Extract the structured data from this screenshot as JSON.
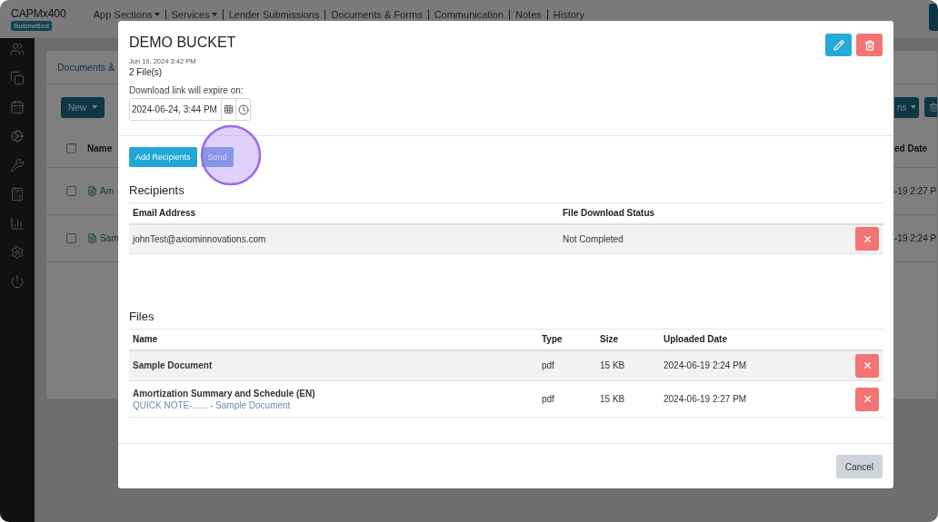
{
  "header": {
    "app_name": "CAPMx400",
    "status_badge": "Submitted",
    "nav": [
      {
        "label": "App Sections",
        "dropdown": true
      },
      {
        "label": "Services",
        "dropdown": true
      },
      {
        "label": "Lender Submissions",
        "dropdown": false
      },
      {
        "label": "Documents & Forms",
        "dropdown": false
      },
      {
        "label": "Communication",
        "dropdown": false
      },
      {
        "label": "Notes",
        "dropdown": false
      },
      {
        "label": "History",
        "dropdown": false
      }
    ]
  },
  "background_panel": {
    "tab": "Documents &",
    "new_button": "New",
    "select_all_checked": false,
    "name_header": "Name",
    "right_button": "ns",
    "date_header": "ed Date",
    "rows": [
      {
        "checked": false,
        "name": "Am",
        "date": "-19 2:27 P"
      },
      {
        "checked": false,
        "name": "Sam",
        "date": "-19 2:24 P"
      }
    ]
  },
  "modal": {
    "title": "DEMO BUCKET",
    "created": "Jun 19, 2024 3:42 PM",
    "file_count": "2 File(s)",
    "expiry_label": "Download link will expire on:",
    "expiry_value": "2024-06-24, 3:44 PM",
    "actions": [
      "Add Recipients",
      "Send"
    ],
    "recipients": {
      "title": "Recipients",
      "columns": [
        "Email Address",
        "File Download Status"
      ],
      "rows": [
        {
          "email": "johnTest@axiominnovations.com",
          "status": "Not Completed"
        }
      ]
    },
    "files": {
      "title": "Files",
      "columns": [
        "Name",
        "Type",
        "Size",
        "Uploaded Date"
      ],
      "rows": [
        {
          "name": "Sample Document",
          "type": "pdf",
          "size": "15 KB",
          "uploaded": "2024-06-19 2:24 PM"
        },
        {
          "name": "Amortization Summary and Schedule (EN)",
          "note": "QUICK NOTE-...... - Sample Document",
          "type": "pdf",
          "size": "15 KB",
          "uploaded": "2024-06-19 2:27 PM"
        }
      ]
    },
    "cancel_button": "Cancel"
  }
}
